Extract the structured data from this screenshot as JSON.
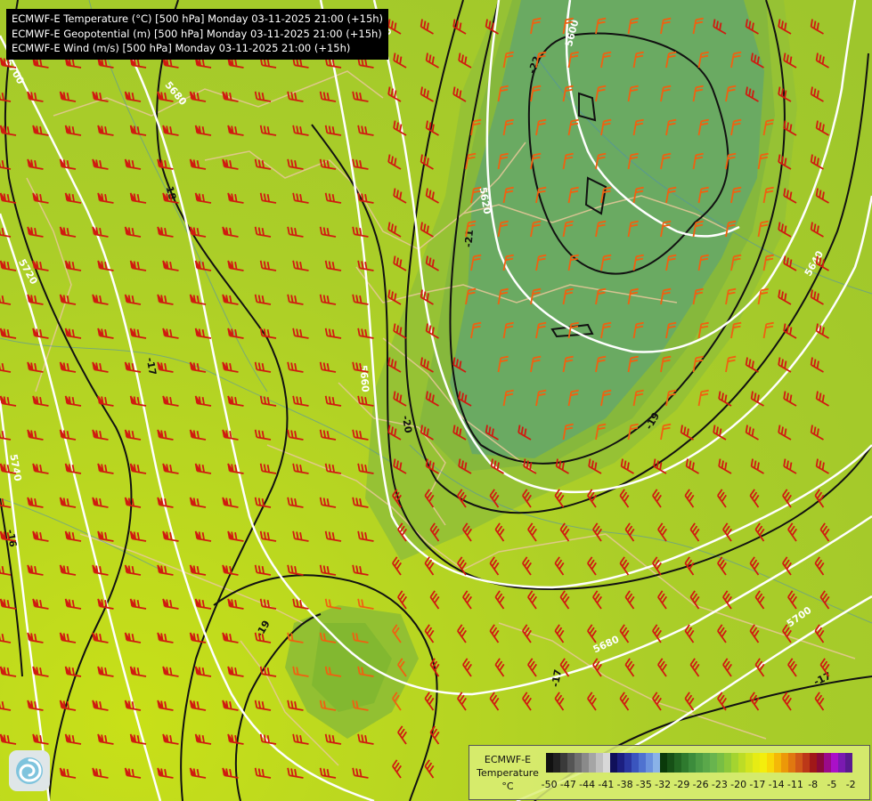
{
  "title_lines": [
    "ECMWF-E Temperature (°C) [500 hPa] Monday 03-11-2025 21:00 (+15h)",
    "ECMWF-E Geopotential (m) [500 hPa] Monday 03-11-2025 21:00 (+15h)",
    "ECMWF-E Wind (m/s) [500 hPa] Monday 03-11-2025 21:00 (+15h)"
  ],
  "legend": {
    "model": "ECMWF-E",
    "variable": "Temperature",
    "unit": "°C",
    "ticks": [
      "-50",
      "-47",
      "-44",
      "-41",
      "-38",
      "-35",
      "-32",
      "-29",
      "-26",
      "-23",
      "-20",
      "-17",
      "-14",
      "-11",
      "-8",
      "-5",
      "-2"
    ],
    "colors": [
      "#111111",
      "#222222",
      "#3a3a3a",
      "#555555",
      "#707070",
      "#8a8a8a",
      "#a5a5a5",
      "#c0c0c0",
      "#d8d8d8",
      "#10105a",
      "#1c1f80",
      "#2a36a0",
      "#3a55be",
      "#4f72d0",
      "#6b92de",
      "#8ab2e8",
      "#0a3a0a",
      "#165016",
      "#226622",
      "#2e7a2e",
      "#3c8c3c",
      "#4c9c44",
      "#5aa84a",
      "#68b44e",
      "#78be44",
      "#8cc83a",
      "#a4d430",
      "#bcdc26",
      "#d2e41e",
      "#e6ec14",
      "#f4ee0c",
      "#f8d808",
      "#f4b808",
      "#ec9808",
      "#e07810",
      "#d05818",
      "#bc3818",
      "#a01818",
      "#8a0a3a",
      "#9a0a8a",
      "#aa10c8",
      "#7a1ab0",
      "#5a1a90"
    ]
  },
  "geopotential_labels": [
    "5600",
    "5620",
    "5640",
    "5660",
    "5680",
    "5700",
    "5720",
    "5740"
  ],
  "temperature_labels": [
    "-22",
    "-21",
    "-20",
    "-19",
    "-18",
    "-17",
    "-16"
  ],
  "colors": {
    "cold_core": "#6aaa62",
    "mid_core": "#86bc3a",
    "field": "#a8cc2a",
    "warm_edge": "#c2dc1c",
    "barb_red": "#d01a10",
    "barb_orange": "#f06010"
  }
}
